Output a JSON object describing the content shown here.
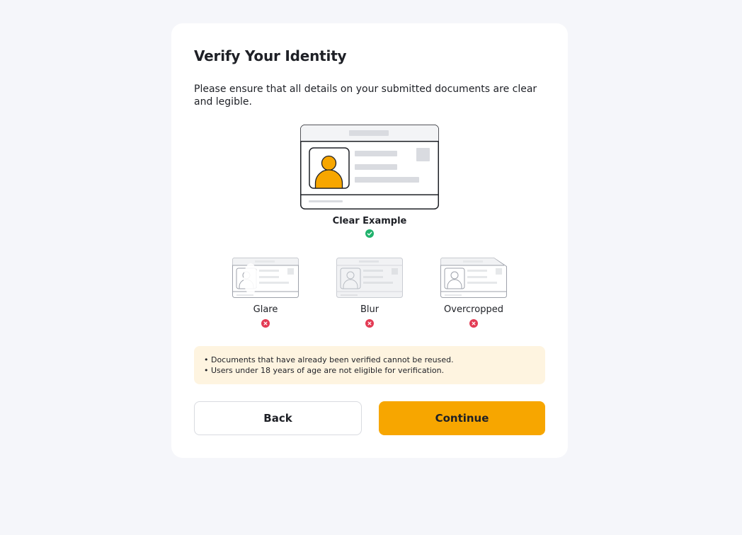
{
  "dialog": {
    "title": "Verify Your Identity",
    "description": "Please ensure that all details on your submitted documents are clear and legible."
  },
  "examples": {
    "good": {
      "label": "Clear Example",
      "status_icon": "check-circle-icon",
      "color": "#20b26c"
    },
    "bad": [
      {
        "label": "Glare",
        "status_icon": "x-circle-icon"
      },
      {
        "label": "Blur",
        "status_icon": "x-circle-icon"
      },
      {
        "label": "Overcropped",
        "status_icon": "x-circle-icon"
      }
    ],
    "bad_color": "#e33b54"
  },
  "notice": {
    "items": [
      "• Documents that have already been verified cannot be reused.",
      "• Users under 18 years of age are not eligible for verification."
    ]
  },
  "actions": {
    "back_label": "Back",
    "continue_label": "Continue",
    "accent_color": "#f7a600"
  }
}
